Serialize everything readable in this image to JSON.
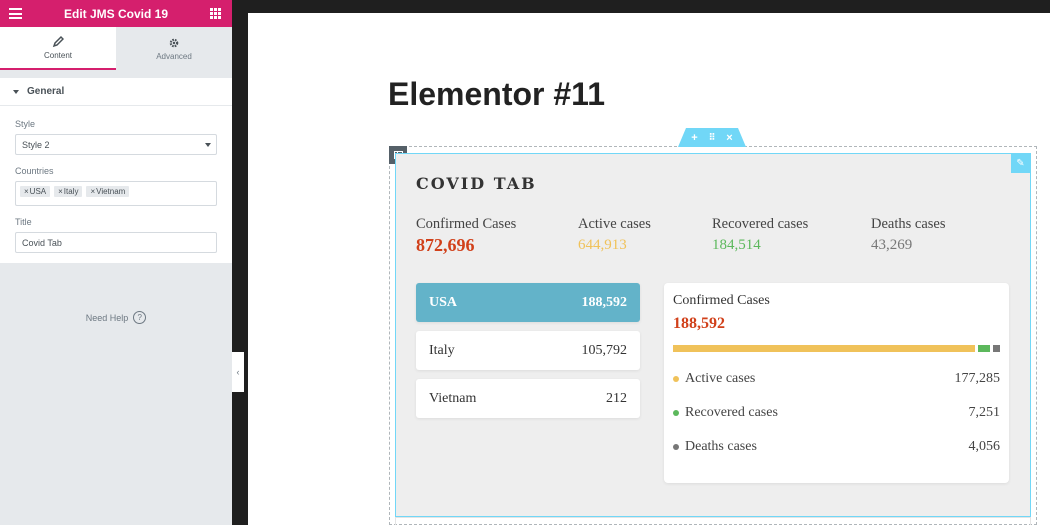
{
  "editor": {
    "title": "Edit JMS Covid 19",
    "tabs": [
      {
        "label": "Content",
        "icon": "pencil-icon",
        "active": true
      },
      {
        "label": "Advanced",
        "icon": "gear-icon",
        "active": false
      }
    ],
    "section_title": "General",
    "controls": {
      "style_label": "Style",
      "style_value": "Style 2",
      "countries_label": "Countries",
      "countries": [
        "USA",
        "Italy",
        "Vietnam"
      ],
      "title_label": "Title",
      "title_value": "Covid Tab"
    },
    "need_help": "Need Help"
  },
  "page": {
    "title": "Elementor #11"
  },
  "widget": {
    "title": "COVID TAB",
    "summary": [
      {
        "label": "Confirmed Cases",
        "value": "872,696",
        "color": "#d1401a"
      },
      {
        "label": "Active cases",
        "value": "644,913",
        "color": "#f0c25a"
      },
      {
        "label": "Recovered cases",
        "value": "184,514",
        "color": "#5cb85c"
      },
      {
        "label": "Deaths cases",
        "value": "43,269",
        "color": "#777777"
      }
    ],
    "countries": [
      {
        "name": "USA",
        "value": "188,592",
        "active": true
      },
      {
        "name": "Italy",
        "value": "105,792",
        "active": false
      },
      {
        "name": "Vietnam",
        "value": "212",
        "active": false
      }
    ],
    "detail": {
      "label": "Confirmed Cases",
      "value": "188,592",
      "value_color": "#d1401a",
      "bar": [
        {
          "name": "active",
          "value": 177285,
          "color": "#f0c25a"
        },
        {
          "name": "recovered",
          "value": 7251,
          "color": "#5cb85c"
        },
        {
          "name": "deaths",
          "value": 4056,
          "color": "#777777"
        }
      ],
      "rows": [
        {
          "label": "Active cases",
          "value": "177,285",
          "color": "#f0c25a"
        },
        {
          "label": "Recovered cases",
          "value": "7,251",
          "color": "#5cb85c"
        },
        {
          "label": "Deaths cases",
          "value": "4,056",
          "color": "#777777"
        }
      ]
    }
  },
  "colors": {
    "brand": "#d51f6d",
    "accent": "#71d7f7",
    "active_country": "#63b3c9"
  }
}
